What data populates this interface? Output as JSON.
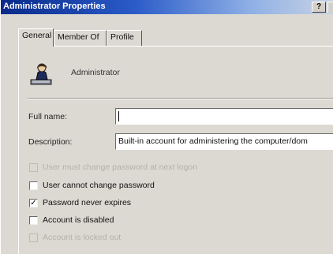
{
  "window": {
    "title": "Administrator Properties",
    "help_label": "?"
  },
  "tabs": [
    {
      "label": "General",
      "active": true
    },
    {
      "label": "Member Of",
      "active": false
    },
    {
      "label": "Profile",
      "active": false
    }
  ],
  "user": {
    "icon": "user-icon",
    "name": "Administrator"
  },
  "fields": {
    "full_name": {
      "label": "Full name:",
      "value": ""
    },
    "description": {
      "label": "Description:",
      "value": "Built-in account for administering the computer/dom"
    }
  },
  "options": [
    {
      "label": "User must change password at next logon",
      "checked": false,
      "disabled": true
    },
    {
      "label": "User cannot change password",
      "checked": false,
      "disabled": false
    },
    {
      "label": "Password never expires",
      "checked": true,
      "disabled": false
    },
    {
      "label": "Account is disabled",
      "checked": false,
      "disabled": false
    },
    {
      "label": "Account is locked out",
      "checked": false,
      "disabled": true
    }
  ]
}
